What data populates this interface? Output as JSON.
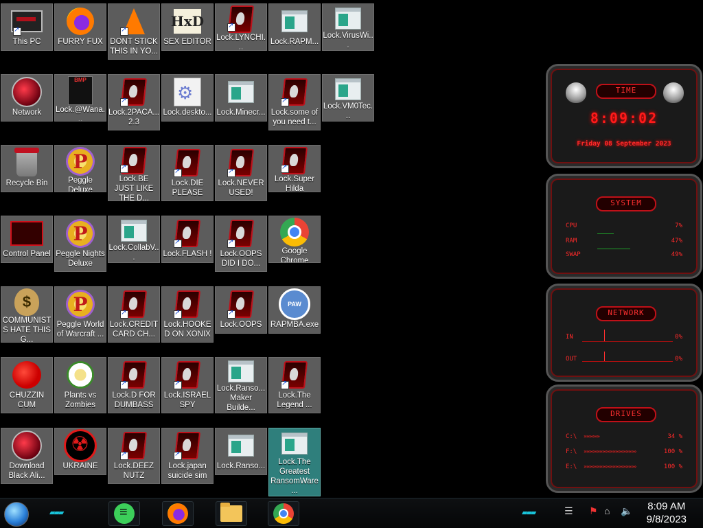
{
  "desktop": {
    "icons": [
      {
        "label": "This PC",
        "art": "monitor"
      },
      {
        "label": "FURRY FUX",
        "art": "firefox"
      },
      {
        "label": "DONT STICK THIS IN YO...",
        "art": "cone"
      },
      {
        "label": "SEX EDITOR",
        "art": "hxd"
      },
      {
        "label": "Lock.LYNCHI...",
        "art": "redbox"
      },
      {
        "label": "Lock.RAPM...",
        "art": "win"
      },
      {
        "label": "Lock.VirusWi...",
        "art": "win"
      },
      {
        "label": "Network",
        "art": "bigball"
      },
      {
        "label": "Lock.@Wana...",
        "art": "bmp"
      },
      {
        "label": "Lock.2PACA... 2.3",
        "art": "redbox"
      },
      {
        "label": "Lock.deskto...",
        "art": "cog"
      },
      {
        "label": "Lock.Minecr...",
        "art": "win"
      },
      {
        "label": "Lock.some of you need t...",
        "art": "redbox"
      },
      {
        "label": "Lock.VM0Tec...",
        "art": "win"
      },
      {
        "label": "Recycle Bin",
        "art": "bin"
      },
      {
        "label": "Peggle Deluxe",
        "art": "peggle"
      },
      {
        "label": "Lock.BE JUST LIKE THE D...",
        "art": "redbox"
      },
      {
        "label": "Lock.DIE PLEASE",
        "art": "redbox"
      },
      {
        "label": "Lock.NEVER USED!",
        "art": "redbox"
      },
      {
        "label": "Lock.Super Hilda",
        "art": "redbox"
      },
      {
        "label": "Control Panel",
        "art": "panel"
      },
      {
        "label": "Peggle Nights Deluxe",
        "art": "peggle"
      },
      {
        "label": "Lock.CollabV...",
        "art": "win"
      },
      {
        "label": "Lock.FLASH !",
        "art": "redbox"
      },
      {
        "label": "Lock.OOPS DID I DO...",
        "art": "redbox"
      },
      {
        "label": "Google Chrome",
        "art": "chrome"
      },
      {
        "label": "COMMUNISTS HATE THIS G...",
        "art": "moneybag"
      },
      {
        "label": "Peggle World of Warcraft ...",
        "art": "peggle"
      },
      {
        "label": "Lock.CREDIT CARD CH...",
        "art": "redbox"
      },
      {
        "label": "Lock.HOOKED ON XONIX",
        "art": "redbox"
      },
      {
        "label": "Lock.OOPS",
        "art": "redbox"
      },
      {
        "label": "RAPMBA.exe",
        "art": "badge"
      },
      {
        "label": "CHUZZIN CUM",
        "art": "fuzz"
      },
      {
        "label": "Plants vs Zombies",
        "art": "flower"
      },
      {
        "label": "Lock.D FOR DUMBASS",
        "art": "redbox"
      },
      {
        "label": "Lock.ISRAEL SPY",
        "art": "redbox"
      },
      {
        "label": "Lock.Ranso... Maker Builde...",
        "art": "win"
      },
      {
        "label": "Lock.The Legend ...",
        "art": "redbox"
      },
      {
        "label": "Download Black Ali...",
        "art": "bigball"
      },
      {
        "label": "UKRAINE",
        "art": "nuke"
      },
      {
        "label": "Lock.DEEZ NUTZ",
        "art": "redbox"
      },
      {
        "label": "Lock.japan suicide sim",
        "art": "redbox"
      },
      {
        "label": "Lock.Ranso...",
        "art": "win"
      },
      {
        "label": "Lock.The Greatest RansomWare ...",
        "art": "win"
      }
    ]
  },
  "gadgets": {
    "time": {
      "title": "TIME",
      "clock": "8:09:02",
      "date": "Friday 08 September 2023"
    },
    "system": {
      "title": "SYSTEM",
      "rows": [
        {
          "label": "CPU",
          "value": "7%"
        },
        {
          "label": "RAM",
          "value": "47%",
          "fraction": 0.47
        },
        {
          "label": "SWAP",
          "value": "49%",
          "fraction": 0.49
        }
      ]
    },
    "network": {
      "title": "NETWORK",
      "rows": [
        {
          "label": "IN",
          "value": "0%"
        },
        {
          "label": "OUT",
          "value": "0%"
        }
      ]
    },
    "drives": {
      "title": "DRIVES",
      "rows": [
        {
          "label": "C:\\",
          "value": "34 %"
        },
        {
          "label": "F:\\",
          "value": "100 %"
        },
        {
          "label": "E:\\",
          "value": "100 %"
        }
      ]
    }
  },
  "taskbar": {
    "clock_time": "8:09 AM",
    "clock_date": "9/8/2023"
  }
}
